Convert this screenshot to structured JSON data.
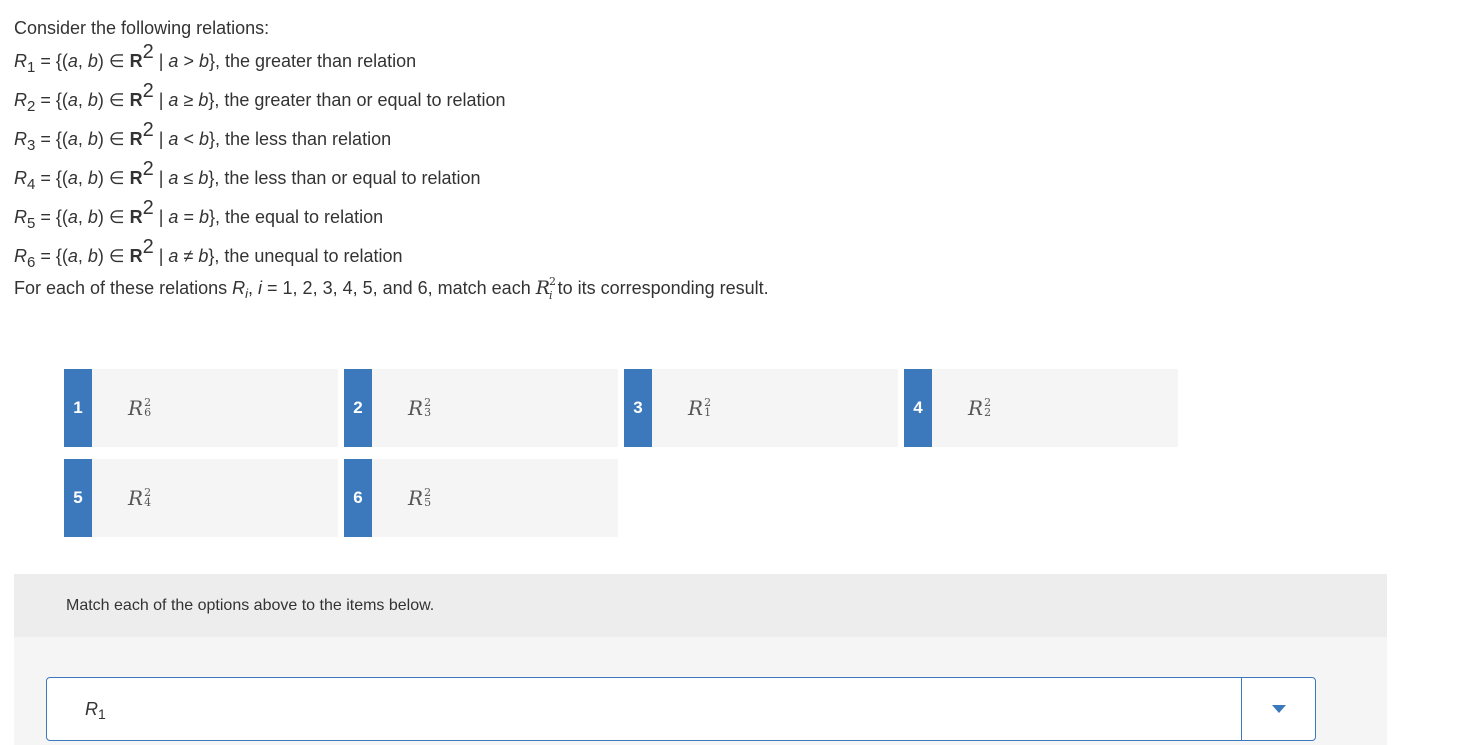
{
  "question": {
    "intro": "Consider the following relations:",
    "relations": [
      {
        "name": "R",
        "sub": "1",
        "prefix": " = {(",
        "a": "a",
        "comma": ", ",
        "b": "b",
        "mid": ") ∈ ",
        "setR": "R",
        "sup": "2",
        "bar": " | ",
        "lhs": "a",
        "op": " > ",
        "rhs": "b",
        "desc": "}, the greater than relation"
      },
      {
        "name": "R",
        "sub": "2",
        "prefix": " = {(",
        "a": "a",
        "comma": ", ",
        "b": "b",
        "mid": ") ∈ ",
        "setR": "R",
        "sup": "2",
        "bar": " | ",
        "lhs": "a",
        "op": " ≥ ",
        "rhs": "b",
        "desc": "}, the greater than or equal to relation"
      },
      {
        "name": "R",
        "sub": "3",
        "prefix": " = {(",
        "a": "a",
        "comma": ", ",
        "b": "b",
        "mid": ") ∈ ",
        "setR": "R",
        "sup": "2",
        "bar": " | ",
        "lhs": "a",
        "op": " < ",
        "rhs": "b",
        "desc": "}, the less than relation"
      },
      {
        "name": "R",
        "sub": "4",
        "prefix": " = {(",
        "a": "a",
        "comma": ", ",
        "b": "b",
        "mid": ") ∈ ",
        "setR": "R",
        "sup": "2",
        "bar": " | ",
        "lhs": "a",
        "op": " ≤ ",
        "rhs": "b",
        "desc": "}, the less than or equal to relation"
      },
      {
        "name": "R",
        "sub": "5",
        "prefix": " = {(",
        "a": "a",
        "comma": ", ",
        "b": "b",
        "mid": ") ∈ ",
        "setR": "R",
        "sup": "2",
        "bar": " | ",
        "lhs": "a",
        "op": " = ",
        "rhs": "b",
        "desc": "}, the equal to relation"
      },
      {
        "name": "R",
        "sub": "6",
        "prefix": " = {(",
        "a": "a",
        "comma": ", ",
        "b": "b",
        "mid": ") ∈ ",
        "setR": "R",
        "sup": "2",
        "bar": " | ",
        "lhs": "a",
        "op": " ≠ ",
        "rhs": "b",
        "desc": "}, the unequal to relation"
      }
    ],
    "instruction_pre": "For each of these relations ",
    "instruction_R": "R",
    "instruction_sub": "i",
    "instruction_mid": ", ",
    "instruction_i": "i",
    "instruction_vals": " = 1, 2, 3, 4, 5, and 6, match each ",
    "instruction_R2": "R",
    "instruction_R2_sup": "2",
    "instruction_R2_sub": "i",
    "instruction_post": " to its corresponding result."
  },
  "options": [
    {
      "num": "1",
      "R": "R",
      "sup": "2",
      "sub": "6"
    },
    {
      "num": "2",
      "R": "R",
      "sup": "2",
      "sub": "3"
    },
    {
      "num": "3",
      "R": "R",
      "sup": "2",
      "sub": "1"
    },
    {
      "num": "4",
      "R": "R",
      "sup": "2",
      "sub": "2"
    },
    {
      "num": "5",
      "R": "R",
      "sup": "2",
      "sub": "4"
    },
    {
      "num": "6",
      "R": "R",
      "sup": "2",
      "sub": "5"
    }
  ],
  "match": {
    "header": "Match each of the options above to the items below.",
    "items": [
      {
        "label_R": "R",
        "label_sub": "1"
      }
    ]
  },
  "colors": {
    "accent": "#3b78bc",
    "panel": "#f5f5f5",
    "header_bg": "#ededed"
  },
  "icons": {
    "dropdown": "caret-down-icon"
  }
}
